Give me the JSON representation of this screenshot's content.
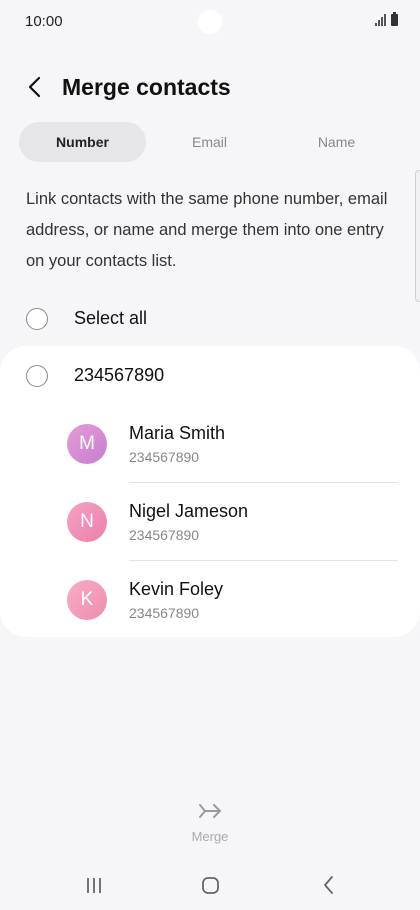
{
  "status_bar": {
    "time": "10:00"
  },
  "header": {
    "title": "Merge contacts"
  },
  "tabs": [
    {
      "label": "Number",
      "active": true
    },
    {
      "label": "Email",
      "active": false
    },
    {
      "label": "Name",
      "active": false
    }
  ],
  "description": "Link contacts with the same phone number, email address, or name and merge them into one entry on your contacts list.",
  "select_all": {
    "label": "Select all"
  },
  "group": {
    "number": "234567890",
    "contacts": [
      {
        "initial": "M",
        "name": "Maria Smith",
        "number": "234567890",
        "avatar_color": "#d98ad0"
      },
      {
        "initial": "N",
        "name": "Nigel Jameson",
        "number": "234567890",
        "avatar_color": "#f08db4"
      },
      {
        "initial": "K",
        "name": "Kevin Foley",
        "number": "234567890",
        "avatar_color": "#f39ab5"
      }
    ]
  },
  "merge": {
    "label": "Merge",
    "icon": "merge-arrows-icon"
  },
  "colors": {
    "background": "#f6f6f8",
    "card": "#ffffff",
    "active_tab": "#e6e6ea"
  }
}
